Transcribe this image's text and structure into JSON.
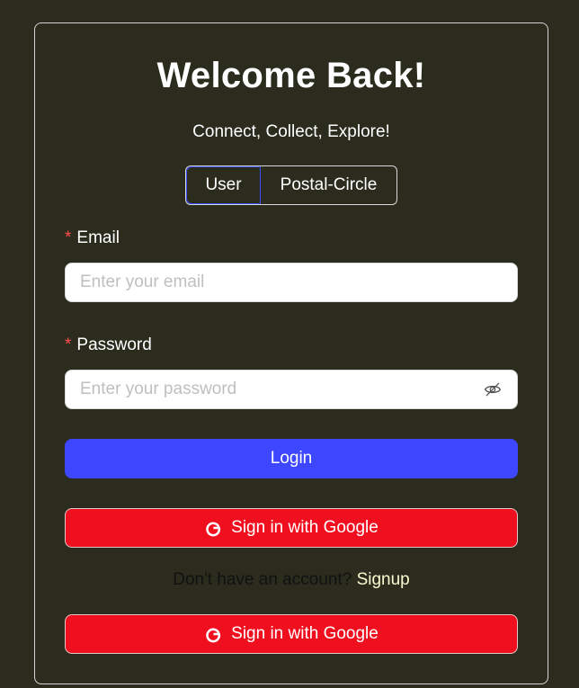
{
  "heading": "Welcome Back!",
  "tagline": "Connect, Collect, Explore!",
  "segmented": {
    "options": [
      "User",
      "Postal-Circle"
    ],
    "selected": "User"
  },
  "email": {
    "label": "Email",
    "required_mark": "*",
    "placeholder": "Enter your email",
    "value": ""
  },
  "password": {
    "label": "Password",
    "required_mark": "*",
    "placeholder": "Enter your password",
    "value": "",
    "toggle_icon": "eye-slash-icon"
  },
  "login_button": "Login",
  "google_button_top": "Sign in with Google",
  "signup_prompt": "Don't have an account?",
  "signup_link": "Signup",
  "google_button_bottom": "Sign in with Google",
  "colors": {
    "background": "#2b2c1e",
    "primary": "#3d47ff",
    "google": "#f00f1f",
    "required": "#ff4d4f",
    "link": "#fafad2"
  }
}
